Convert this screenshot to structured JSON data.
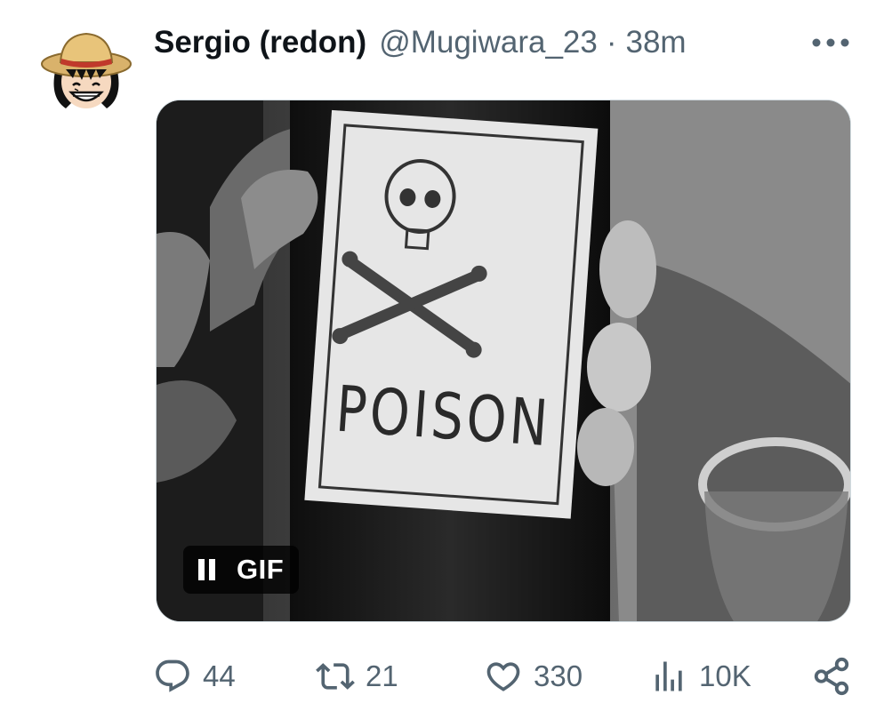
{
  "author": {
    "name": "Sergio (redon)",
    "handle": "@Mugiwara_23",
    "separator": "·",
    "time": "38m",
    "avatar_icon": "straw-hat-character-avatar"
  },
  "header": {
    "more_icon": "more-options-icon"
  },
  "media": {
    "type": "gif",
    "label_text": "POISON",
    "badge_label": "GIF",
    "badge_icon": "pause-icon"
  },
  "actions": {
    "reply": {
      "icon": "reply-icon",
      "count": "44"
    },
    "retweet": {
      "icon": "retweet-icon",
      "count": "21"
    },
    "like": {
      "icon": "heart-icon",
      "count": "330"
    },
    "views": {
      "icon": "analytics-icon",
      "count": "10K"
    },
    "share": {
      "icon": "share-icon"
    }
  },
  "colors": {
    "text_primary": "#0f1419",
    "text_secondary": "#536471",
    "border": "#cfd9de"
  }
}
